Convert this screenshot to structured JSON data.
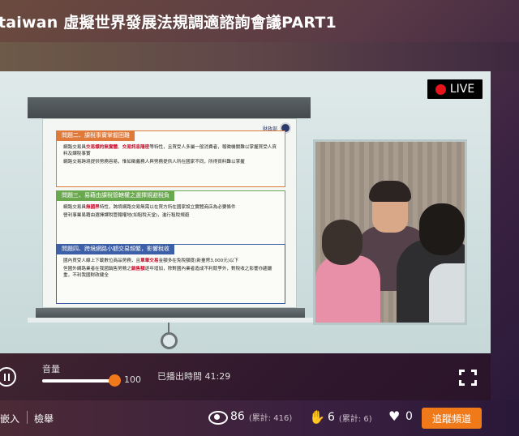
{
  "page": {
    "title": "taiwan 虛擬世界發展法規調適諮詢會議PART1"
  },
  "video": {
    "live_label": "LIVE",
    "slide": {
      "ministry": "財政部",
      "sections": [
        {
          "heading": "問題二、課稅事實掌握困難",
          "bullets": [
            "網路交易具交易標的無實體、交易訊息隱密等特性，且買受人多屬一般消費者，稽徵機關難以掌握買受人資料及課稅事實",
            "網路交易跨境提供勞務容易，惟如徵義務人與勞務提供人所在國家不同，所得資料難以掌握"
          ]
        },
        {
          "heading": "問題三、易藉由課稅管轄權之選擇規避稅負",
          "bullets": [
            "網路交易具無國界特性，跨境網路交易無需以在買方所在國家設立實體商店為必要條件",
            "營利事業易藉由選擇課稅管轄權地(如租稅天堂)，進行租稅規避"
          ]
        },
        {
          "heading": "問題四、跨境網路小額交易頻繁，影響稅收",
          "bullets": [
            "國內買受人線上下載數位商品勞務，且單筆交易金額多在免稅額度(新臺幣3,000元)以下",
            "但國外網路業者在我國銷售勞務之銷售額逐年增加，除對國內業者造成不利競爭外，對稅收之影響亦趨嚴重，不利我國財政健全"
          ]
        }
      ]
    }
  },
  "controls": {
    "volume_label": "音量",
    "volume_value": "100",
    "volume_level": 0.92,
    "played_time": "已播出時間 41:29"
  },
  "footer": {
    "embed_label": "嵌入",
    "report_label": "檢舉",
    "views": "86",
    "views_total": "(累計: 416)",
    "claps": "6",
    "claps_total": "(累計: 6)",
    "likes": "0",
    "follow_label": "追蹤頻道"
  },
  "icons": {
    "live": "live-dot-icon",
    "pause": "pause-icon",
    "fullscreen": "fullscreen-icon",
    "views": "eye-icon",
    "claps": "clap-icon",
    "likes": "heart-icon"
  },
  "colors": {
    "accent": "#f07a1a",
    "live_red": "#e8141c"
  }
}
